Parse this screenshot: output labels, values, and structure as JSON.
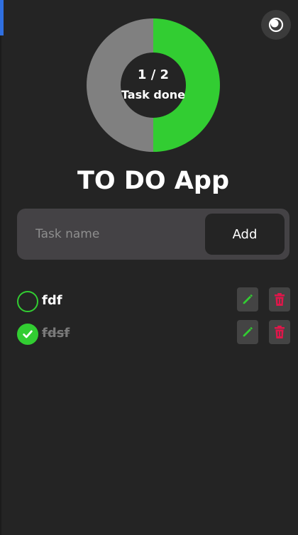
{
  "app": {
    "title": "TO DO App"
  },
  "progress": {
    "completed": 1,
    "total": 2,
    "count_text": "1 / 2",
    "label": "Task done",
    "done_fraction": 0.5
  },
  "theme_toggle": {
    "icon": "moon-icon"
  },
  "form": {
    "input_value": "",
    "placeholder": "Task name",
    "add_label": "Add"
  },
  "tasks": [
    {
      "name": "fdf",
      "completed": false
    },
    {
      "name": "fdsf",
      "completed": true
    }
  ],
  "icons": {
    "edit": "pencil-icon",
    "delete": "trash-icon"
  },
  "colors": {
    "background": "#242424",
    "panel": "#444245",
    "accent_green": "#32cd32",
    "donut_remaining": "#808080",
    "danger_red": "#e0164a",
    "scroll_blue": "#2f6fe0"
  }
}
